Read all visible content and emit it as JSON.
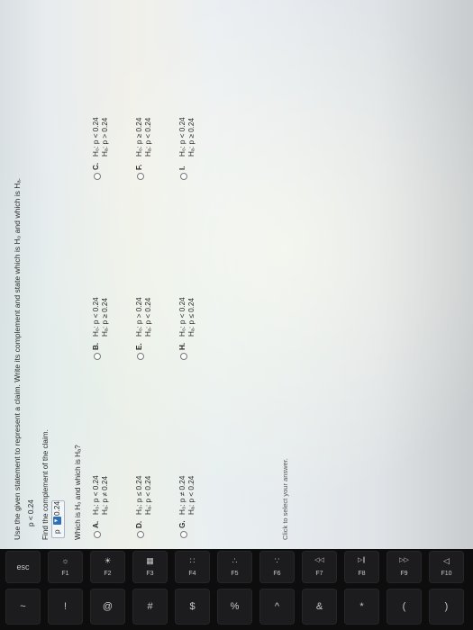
{
  "question": {
    "instruction": "Use the given statement to represent a claim. Write its complement and state which is H₀ and which is Hₐ.",
    "claim": "p < 0.24",
    "find_label": "Find the complement of the claim.",
    "complement_dropdown": {
      "variable": "p",
      "selected": "0.24"
    },
    "which_label": "Which is H₀ and which is Hₐ?",
    "options": [
      {
        "letter": "A.",
        "h0": "H₀: p < 0.24",
        "ha": "Hₐ: p ≠ 0.24"
      },
      {
        "letter": "B.",
        "h0": "H₀: p < 0.24",
        "ha": "Hₐ: p ≥ 0.24"
      },
      {
        "letter": "C.",
        "h0": "H₀: p < 0.24",
        "ha": "Hₐ: p > 0.24"
      },
      {
        "letter": "D.",
        "h0": "H₀: p ≤ 0.24",
        "ha": "Hₐ: p < 0.24"
      },
      {
        "letter": "E.",
        "h0": "H₀: p > 0.24",
        "ha": "Hₐ: p < 0.24"
      },
      {
        "letter": "F.",
        "h0": "H₀: p ≥ 0.24",
        "ha": "Hₐ: p < 0.24"
      },
      {
        "letter": "G.",
        "h0": "H₀: p ≠ 0.24",
        "ha": "Hₐ: p < 0.24"
      },
      {
        "letter": "H.",
        "h0": "H₀: p < 0.24",
        "ha": "Hₐ: p ≤ 0.24"
      },
      {
        "letter": "I.",
        "h0": "H₀: p < 0.24",
        "ha": "Hₐ: p ≥ 0.24"
      }
    ],
    "hint": "Click to select your answer."
  },
  "keyboard": {
    "function_row": [
      {
        "top": "",
        "bottom": "esc"
      },
      {
        "top": "☼",
        "bottom": "F1"
      },
      {
        "top": "☀",
        "bottom": "F2"
      },
      {
        "top": "▦",
        "bottom": "F3"
      },
      {
        "top": "∷",
        "bottom": "F4"
      },
      {
        "top": "∴",
        "bottom": "F5"
      },
      {
        "top": "∵",
        "bottom": "F6"
      },
      {
        "top": "◁◁",
        "bottom": "F7"
      },
      {
        "top": "▷∥",
        "bottom": "F8"
      },
      {
        "top": "▷▷",
        "bottom": "F9"
      },
      {
        "top": "◁",
        "bottom": "F10"
      }
    ],
    "number_row": [
      "~",
      "!",
      "@",
      "#",
      "$",
      "%",
      "^",
      "&",
      "*",
      "(",
      ")"
    ]
  }
}
